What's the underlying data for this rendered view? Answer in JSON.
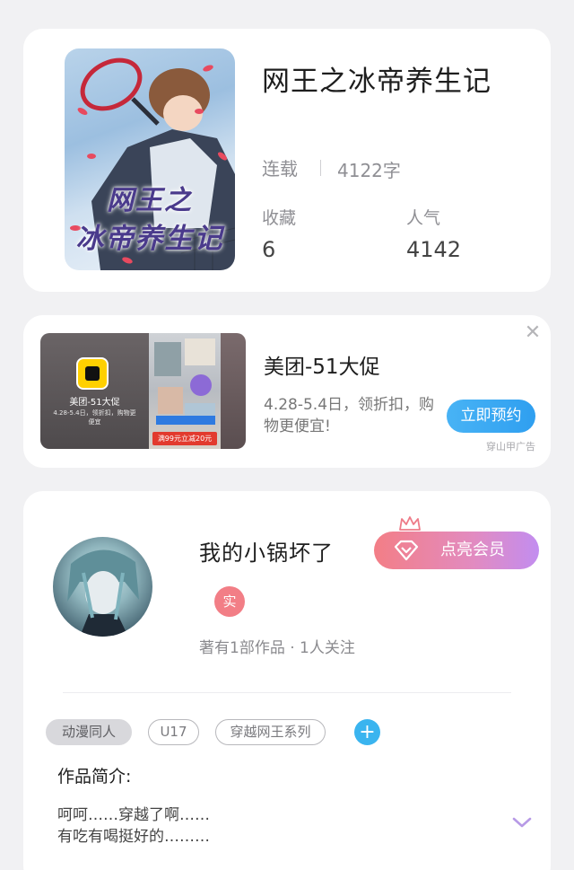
{
  "book": {
    "cover_title_line1": "网王之",
    "cover_title_line2": "冰帝养生记",
    "title": "网王之冰帝养生记",
    "status": "连载",
    "word_count": "4122字",
    "favorites_label": "收藏",
    "favorites_value": "6",
    "popularity_label": "人气",
    "popularity_value": "4142"
  },
  "ad": {
    "mini_title": "美团-51大促",
    "mini_desc": "4.28-5.4日，领折扣，购物更便宜",
    "promo_strip": "满99元立减20元",
    "title": "美团-51大促",
    "description": "4.28-5.4日，领折扣，购物更便宜!",
    "button_label": "立即预约",
    "source": "穿山甲广告",
    "close_icon": "close-icon"
  },
  "author": {
    "name": "我的小锅坏了",
    "vip_button_label": "点亮会员",
    "real_badge": "实",
    "meta": "著有1部作品 · 1人关注",
    "tags": [
      "动漫同人",
      "U17",
      "穿越网王系列"
    ],
    "add_tag_symbol": "+",
    "intro_heading": "作品简介:",
    "intro_line1": "呵呵……穿越了啊……",
    "intro_line2": "有吃有喝挺好的………"
  },
  "colors": {
    "background": "#f1f1f3",
    "ad_button": "#2f9ff0",
    "vip_gradient_start": "#f37e86",
    "vip_gradient_end": "#c28df0",
    "real_badge": "#f27e86",
    "tag_add": "#3ab4ef",
    "expand_chevron": "#b79ae6"
  }
}
